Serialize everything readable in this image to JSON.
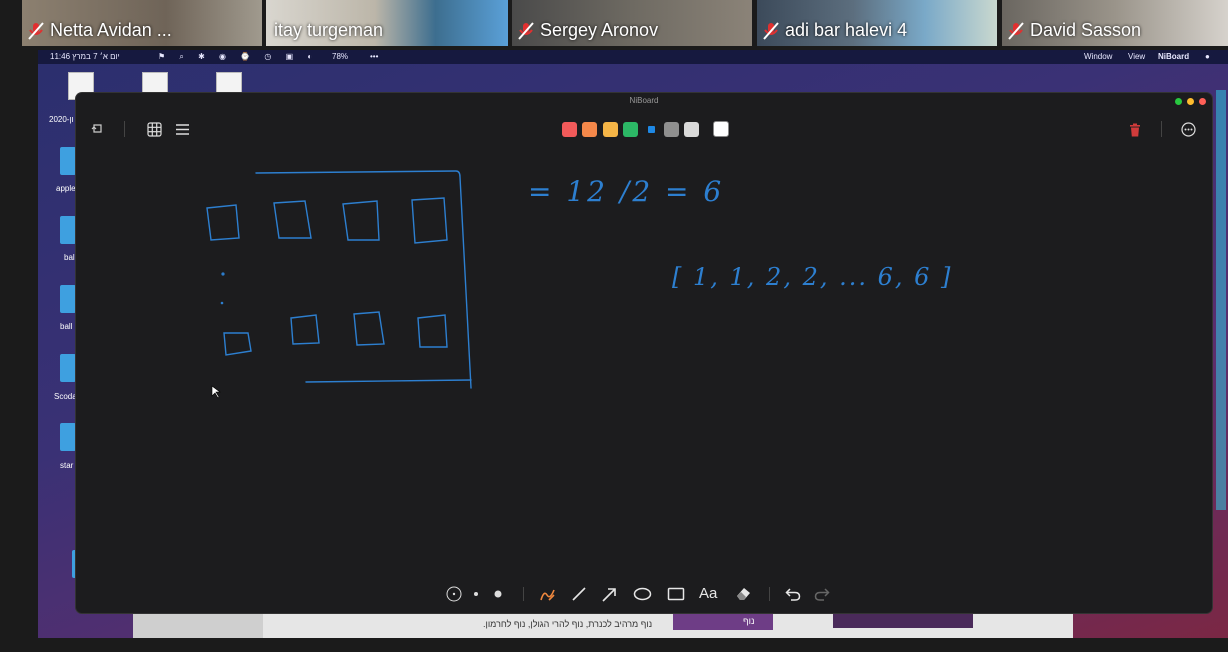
{
  "participants": [
    {
      "name": "Netta Avidan ...",
      "muted": true
    },
    {
      "name": "itay turgeman",
      "muted": false
    },
    {
      "name": "Sergey Aronov",
      "muted": true
    },
    {
      "name": "adi bar halevi 4",
      "muted": true
    },
    {
      "name": "David Sasson",
      "muted": true
    }
  ],
  "menubar": {
    "time_date": "11:46 יום א׳ 7 במרץ",
    "battery": "78%",
    "menu_window": "Window",
    "menu_view": "View",
    "menu_app": "NiBoard"
  },
  "desktop": {
    "icons": [
      "2020-ון",
      "apple",
      "bal",
      "ball",
      "Scoda",
      "star"
    ]
  },
  "window": {
    "title": "NiBoard",
    "palette_colors": [
      "#f25a5a",
      "#f5884a",
      "#f5b547",
      "#2cb866",
      "#1e88e5",
      "#8f8f8f",
      "#d9d9d9",
      "#ffffff"
    ]
  },
  "whiteboard": {
    "equation": "= 12 /2 = 6",
    "set_text": "[ 1, 1, 2, 2, ... 6, 6 ]"
  },
  "toolbar": {
    "text_tool_label": "Aa"
  },
  "bottom_text": {
    "left": "נוף מרהיב לכנרת, נוף להרי הגולן, נוף לחרמון.",
    "right": "נוף"
  }
}
